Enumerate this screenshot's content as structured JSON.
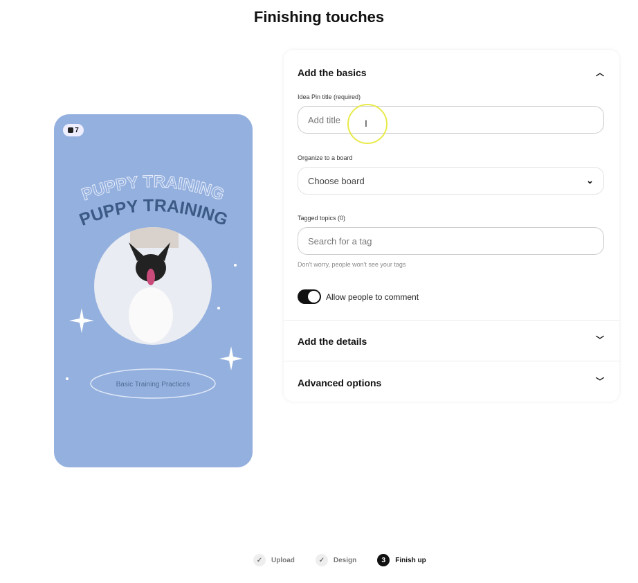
{
  "page_title": "Finishing touches",
  "preview": {
    "page_count": "7",
    "headline_outline": "PUPPY TRAINING",
    "headline": "PUPPY TRAINING",
    "subtitle": "Basic Training Practices",
    "bg_color": "#94b0de"
  },
  "basics": {
    "header": "Add the basics",
    "title_label": "Idea Pin title (required)",
    "title_placeholder": "Add title",
    "board_label": "Organize to a board",
    "board_value": "Choose board",
    "tags_label": "Tagged topics (0)",
    "tags_placeholder": "Search for a tag",
    "tags_help": "Don't worry, people won't see your tags",
    "comment_label": "Allow people to comment",
    "comment_enabled": true
  },
  "details": {
    "header": "Add the details"
  },
  "advanced": {
    "header": "Advanced options"
  },
  "steps": [
    {
      "label": "Upload",
      "state": "done"
    },
    {
      "label": "Design",
      "state": "done"
    },
    {
      "label": "Finish up",
      "number": "3",
      "state": "current"
    }
  ]
}
